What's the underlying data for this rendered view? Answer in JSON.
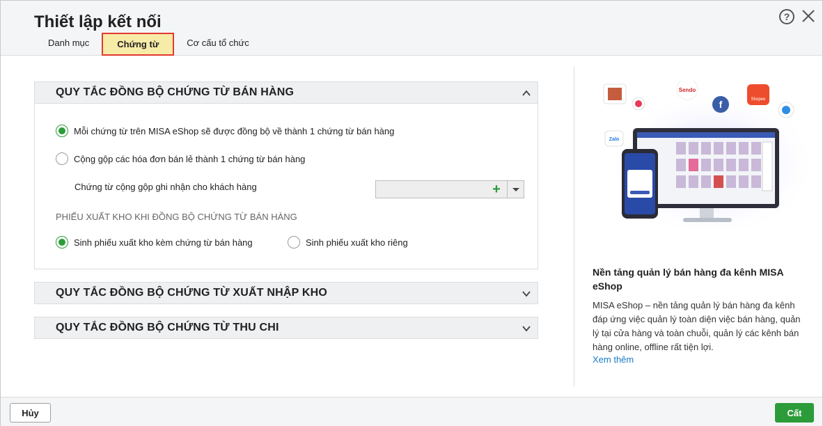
{
  "dialog": {
    "title": "Thiết lập kết nối",
    "help_icon": "help-circle-icon",
    "close_icon": "close-icon"
  },
  "tabs": [
    {
      "label": "Danh mục",
      "active": false
    },
    {
      "label": "Chứng từ",
      "active": true
    },
    {
      "label": "Cơ cấu tổ chức",
      "active": false
    }
  ],
  "sections": [
    {
      "title": "QUY TẮC ĐỒNG BỘ CHỨNG TỪ BÁN HÀNG",
      "expanded": true,
      "options": [
        {
          "label": "Mỗi chứng từ trên MISA eShop sẽ được đồng bộ về thành 1 chứng từ bán hàng",
          "checked": true
        },
        {
          "label": "Cộng gộp các hóa đơn bán lẻ thành 1 chứng từ bán hàng",
          "checked": false
        }
      ],
      "combo_label": "Chứng từ cộng gộp ghi nhận cho khách hàng",
      "combo_value": "",
      "subheading": "PHIẾU XUẤT KHO KHI ĐỒNG BỘ CHỨNG TỪ BÁN HÀNG",
      "export_options": [
        {
          "label": "Sinh phiếu xuất kho kèm chứng từ bán hàng",
          "checked": true
        },
        {
          "label": "Sinh phiếu xuất kho riêng",
          "checked": false
        }
      ]
    },
    {
      "title": "QUY TẮC ĐỒNG BỘ CHỨNG TỪ XUẤT NHẬP KHO",
      "expanded": false
    },
    {
      "title": "QUY TẮC ĐỒNG BỘ CHỨNG TỪ THU CHI",
      "expanded": false
    }
  ],
  "promo": {
    "title": "Nền tảng quản lý bán hàng đa kênh MISA eShop",
    "text": "MISA eShop – nền tảng quản lý bán hàng đa kênh đáp ứng việc quản lý toàn diện việc bán hàng, quản lý tại cửa hàng và toàn chuỗi, quản lý các kênh bán hàng online, offline rất tiện lợi.",
    "link": "Xem thêm",
    "badges": {
      "sendo": "Sendo",
      "shopee": "Shopee",
      "zalo": "Zalo"
    }
  },
  "footer": {
    "cancel_label": "Hủy",
    "ok_label": "Cất"
  },
  "colors": {
    "accent_green": "#2c9c3a",
    "active_tab_bg": "#f7eba8",
    "active_tab_border": "#e13a2e",
    "link_blue": "#1c7bc6"
  }
}
